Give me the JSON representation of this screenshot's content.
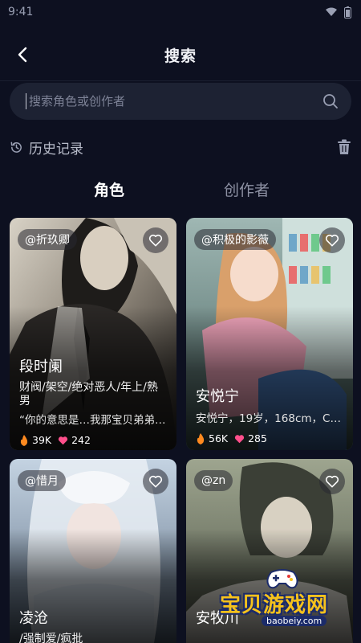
{
  "status_bar": {
    "time": "9:41"
  },
  "header": {
    "title": "搜索"
  },
  "search": {
    "placeholder": "搜索角色或创作者",
    "value": ""
  },
  "history": {
    "title": "历史记录"
  },
  "tabs": [
    {
      "label": "角色",
      "active": true
    },
    {
      "label": "创作者",
      "active": false
    }
  ],
  "cards": [
    {
      "author": "@折玖卿",
      "name": "段时阑",
      "tags": "财阀/架空/绝对恶人/年上/熟男",
      "desc": "“你的意思是…我那宝贝弟弟…",
      "heat": "39K",
      "likes": "242"
    },
    {
      "author": "@积极的影薇",
      "name": "安悦宁",
      "tags": "",
      "desc": "安悦宁，19岁，168cm，C…",
      "heat": "56K",
      "likes": "285"
    },
    {
      "author": "@惜月",
      "name": "凌沧",
      "tags": "/强制爱/疯批",
      "desc": "",
      "heat": "",
      "likes": ""
    },
    {
      "author": "@zn",
      "name": "安牧川",
      "tags": "",
      "desc": "",
      "heat": "",
      "likes": ""
    }
  ],
  "watermark": {
    "text": "宝贝游戏网",
    "url": "baobeiy.com"
  },
  "colors": {
    "background": "#0d1020",
    "search_bg": "#1d2233",
    "heat_icon": "#ff8a1f",
    "likes_icon": "#ff4f8b",
    "watermark_yellow": "#f6c21c"
  },
  "icons": {
    "back": "chevron-left-icon",
    "search": "search-icon",
    "history": "clock-history-icon",
    "delete": "trash-icon",
    "favorite": "heart-outline-icon",
    "heat": "flame-icon",
    "likes": "heart-filled-icon"
  }
}
